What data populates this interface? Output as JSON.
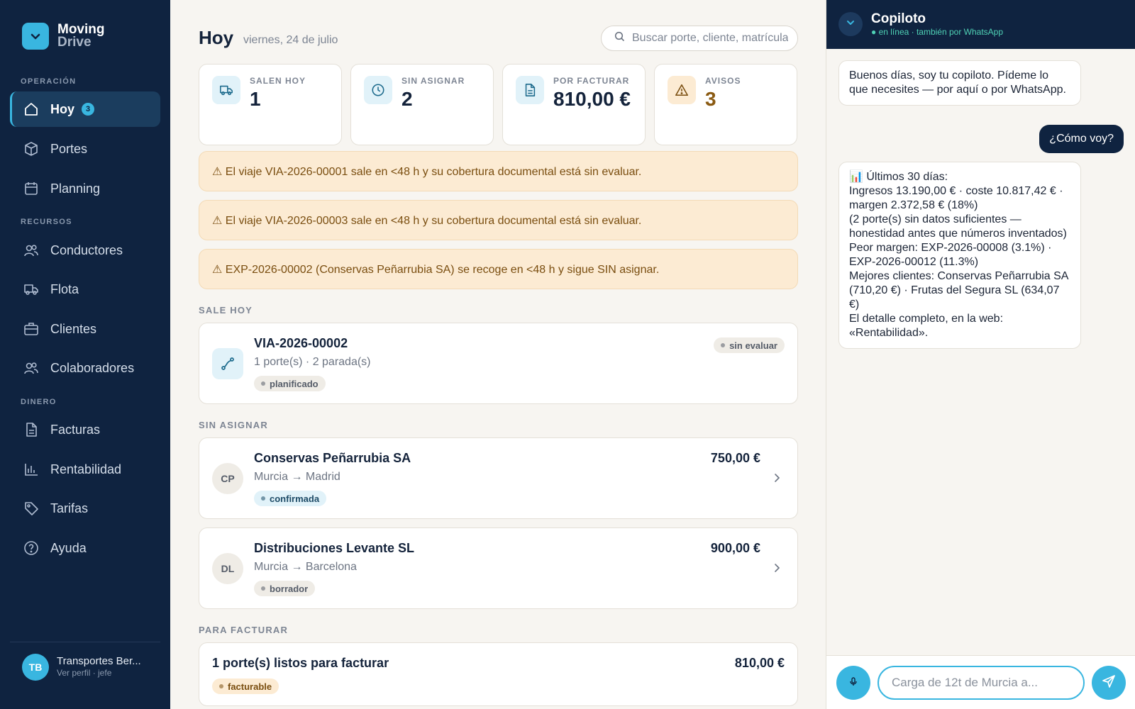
{
  "brand": {
    "name": "Moving",
    "sub": "Drive"
  },
  "sidebar": {
    "sections": {
      "operacion": "OPERACIÓN",
      "recursos": "RECURSOS",
      "dinero": "DINERO"
    },
    "items": [
      {
        "label": "Hoy",
        "icon": "home-icon",
        "badge": "3"
      },
      {
        "label": "Portes",
        "icon": "box-icon"
      },
      {
        "label": "Planning",
        "icon": "calendar-icon"
      },
      {
        "label": "Conductores",
        "icon": "users-icon"
      },
      {
        "label": "Flota",
        "icon": "truck-icon"
      },
      {
        "label": "Clientes",
        "icon": "briefcase-icon"
      },
      {
        "label": "Colaboradores",
        "icon": "users-icon"
      },
      {
        "label": "Facturas",
        "icon": "document-icon"
      },
      {
        "label": "Rentabilidad",
        "icon": "bar-chart-icon"
      },
      {
        "label": "Tarifas",
        "icon": "tag-icon"
      },
      {
        "label": "Ayuda",
        "icon": "help-icon"
      }
    ],
    "profile": {
      "initials": "TB",
      "name": "Transportes Ber...",
      "role": "Ver perfil · jefe"
    }
  },
  "main": {
    "title": "Hoy",
    "date": "viernes, 24 de julio",
    "search_placeholder": "Buscar porte, cliente, matrícula…",
    "stats": [
      {
        "label": "SALEN HOY",
        "value": "1",
        "icon": "truck-icon"
      },
      {
        "label": "SIN ASIGNAR",
        "value": "2",
        "icon": "clock-icon"
      },
      {
        "label": "POR FACTURAR",
        "value": "810,00 €",
        "icon": "document-icon"
      },
      {
        "label": "AVISOS",
        "value": "3",
        "icon": "warning-icon"
      }
    ],
    "alerts": [
      "⚠ El viaje VIA-2026-00001 sale en <48 h y su cobertura documental está sin evaluar.",
      "⚠ El viaje VIA-2026-00003 sale en <48 h y su cobertura documental está sin evaluar.",
      "⚠ EXP-2026-00002 (Conservas Peñarrubia SA) se recoge en <48 h y sigue SIN asignar."
    ],
    "sale_hoy": {
      "heading": "SALE HOY",
      "trip": {
        "id": "VIA-2026-00002",
        "detail": "1 porte(s) · 2 parada(s)",
        "status": "planificado",
        "coverage": "sin evaluar"
      }
    },
    "sin_asignar": {
      "heading": "SIN ASIGNAR",
      "items": [
        {
          "initials": "CP",
          "client": "Conservas Peñarrubia SA",
          "route": "Murcia → Madrid",
          "status": "confirmada",
          "amount": "750,00 €"
        },
        {
          "initials": "DL",
          "client": "Distribuciones Levante SL",
          "route": "Murcia → Barcelona",
          "status": "borrador",
          "amount": "900,00 €"
        }
      ]
    },
    "para_facturar": {
      "heading": "PARA FACTURAR",
      "title": "1 porte(s) listos para facturar",
      "status": "facturable",
      "amount": "810,00 €"
    }
  },
  "copilot": {
    "title": "Copiloto",
    "status": "● en línea · también por WhatsApp",
    "messages": [
      {
        "from": "bot",
        "text": "Buenos días, soy tu copiloto. Pídeme lo que necesites — por aquí o por WhatsApp."
      },
      {
        "from": "user",
        "text": "¿Cómo voy?"
      },
      {
        "from": "bot",
        "text": "📊 Últimos 30 días:\nIngresos 13.190,00 € · coste 10.817,42 € · margen 2.372,58 € (18%)\n(2 porte(s) sin datos suficientes — honestidad antes que números inventados)\nPeor margen: EXP-2026-00008 (3.1%) · EXP-2026-00012 (11.3%)\nMejores clientes: Conservas Peñarrubia SA (710,20 €) · Frutas del Segura SL (634,07 €)\nEl detalle completo, en la web: «Rentabilidad»."
      }
    ],
    "input_placeholder": "Carga de 12t de Murcia a..."
  },
  "colors": {
    "sidebar": "#0f2340",
    "accent": "#39b6e0",
    "warning_bg": "#fcebd3",
    "warning_text": "#7a4e10",
    "background": "#f7f5f1"
  }
}
